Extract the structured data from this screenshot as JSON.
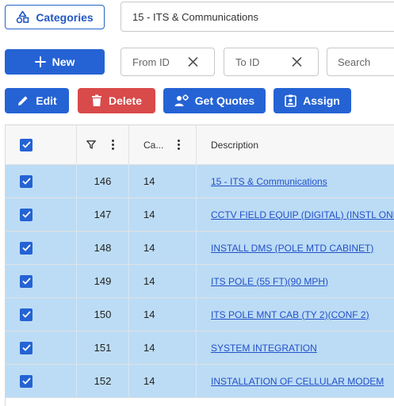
{
  "toolbar": {
    "categories_label": "Categories",
    "category_value": "15 - ITS & Communications",
    "new_label": "New",
    "from_id_placeholder": "From ID",
    "to_id_placeholder": "To ID",
    "search_placeholder": "Search",
    "edit_label": "Edit",
    "delete_label": "Delete",
    "get_quotes_label": "Get Quotes",
    "assign_label": "Assign"
  },
  "grid": {
    "columns": {
      "id": "",
      "category": "Ca...",
      "description": "Description"
    },
    "rows": [
      {
        "id": "146",
        "category": "14",
        "description": "15 - ITS & Communications",
        "checked": true
      },
      {
        "id": "147",
        "category": "14",
        "description": "CCTV FIELD EQUIP (DIGITAL) (INSTL ONLY)",
        "checked": true
      },
      {
        "id": "148",
        "category": "14",
        "description": "INSTALL DMS (POLE MTD CABINET)",
        "checked": true
      },
      {
        "id": "149",
        "category": "14",
        "description": "ITS POLE (55 FT)(90 MPH)",
        "checked": true
      },
      {
        "id": "150",
        "category": "14",
        "description": "ITS POLE MNT CAB (TY 2)(CONF 2)",
        "checked": true
      },
      {
        "id": "151",
        "category": "14",
        "description": "SYSTEM INTEGRATION",
        "checked": true
      },
      {
        "id": "152",
        "category": "14",
        "description": "INSTALLATION OF CELLULAR MODEM",
        "checked": true
      }
    ]
  },
  "colors": {
    "primary": "#2563d4",
    "danger": "#d94a4a",
    "selected_row": "#bcdcf5",
    "link": "#2250c8"
  }
}
